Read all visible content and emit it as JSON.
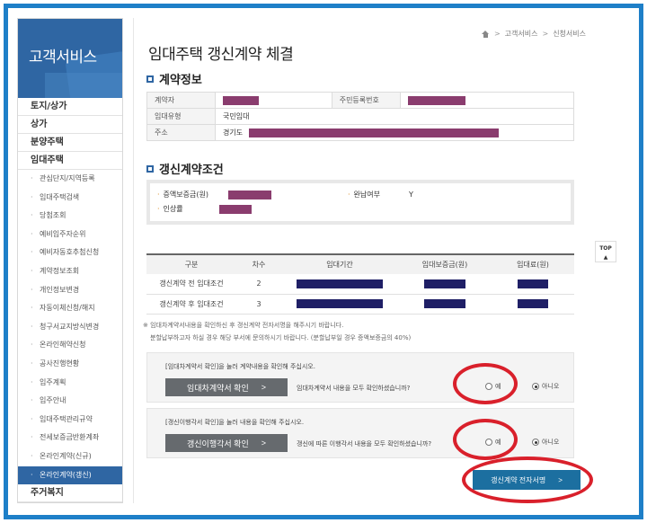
{
  "sidebar": {
    "title": "고객서비스",
    "main_items": [
      "토지/상가",
      "상가",
      "분양주택",
      "임대주택"
    ],
    "sub_items": [
      "관심단지/지역등록",
      "임대주택검색",
      "당첨조회",
      "예비입주자순위",
      "예비자동호추첨신청",
      "계약정보조회",
      "개인정보변경",
      "자동이체신청/해지",
      "청구서교지방식변경",
      "온라인해약신청",
      "공사진행현황",
      "입주계획",
      "입주안내",
      "임대주택관리규약",
      "전세보증금반환계좌",
      "온라인계약(신규)",
      "온라인계약(갱신)"
    ],
    "footer_item": "주거복지"
  },
  "breadcrumb": [
    "고객서비스",
    "신청서비스"
  ],
  "page_title": "임대주택 갱신계약 체결",
  "contract_info": {
    "title": "계약정보",
    "labels": {
      "contractor": "계약자",
      "resident_no": "주민등록번호",
      "rental_type": "임대유형",
      "address": "주소"
    },
    "values": {
      "rental_type": "국민임대",
      "address_prefix": "경기도"
    }
  },
  "renewal_conditions": {
    "title": "갱신계약조건",
    "labels": {
      "deposit_increase": "증액보증금(원)",
      "paid_in_full": "완납여부",
      "increase_rate": "인상률"
    },
    "values": {
      "paid_in_full": "Y"
    }
  },
  "conditions_table": {
    "headers": [
      "구분",
      "차수",
      "임대기간",
      "임대보증금(원)",
      "임대료(원)"
    ],
    "rows": [
      {
        "label": "갱신계약 전 임대조건",
        "round": "2"
      },
      {
        "label": "갱신계약 후 임대조건",
        "round": "3"
      }
    ]
  },
  "notes": {
    "line1": "임대차계약서내용을 확인하신 후 갱신계약 전자서명을 해주시기 바랍니다.",
    "line2": "분할납부하고자 하실 경우 해당 부서에 문의하시기 바랍니다. (분할납부일 경우 증액보증금의 40%)"
  },
  "confirm_lease": {
    "instruction": "[임대차계약서 확인]을 눌러 계약내용을 확인해 주십시오.",
    "button": "임대차계약서 확인",
    "question": "임대차계약서 내용을 모두 확인하셨습니까?",
    "yes": "예",
    "no": "아니오"
  },
  "confirm_duty": {
    "instruction": "[갱신이행각서 확인]을 눌러 내용을 확인해 주십시오.",
    "button": "갱신이행각서 확인",
    "question": "갱신에 따른 이행각서 내용을 모두 확인하셨습니까?",
    "yes": "예",
    "no": "아니오"
  },
  "esign_button": "갱신계약 전자서명",
  "top_button": "TOP",
  "colors": {
    "frame": "#1e7fc8",
    "sidebar_active": "#2f66a3",
    "esign": "#1c6fa0",
    "annotation": "#d9202b",
    "redact_purple": "#8a3c6e",
    "redact_navy": "#1f1f66"
  }
}
